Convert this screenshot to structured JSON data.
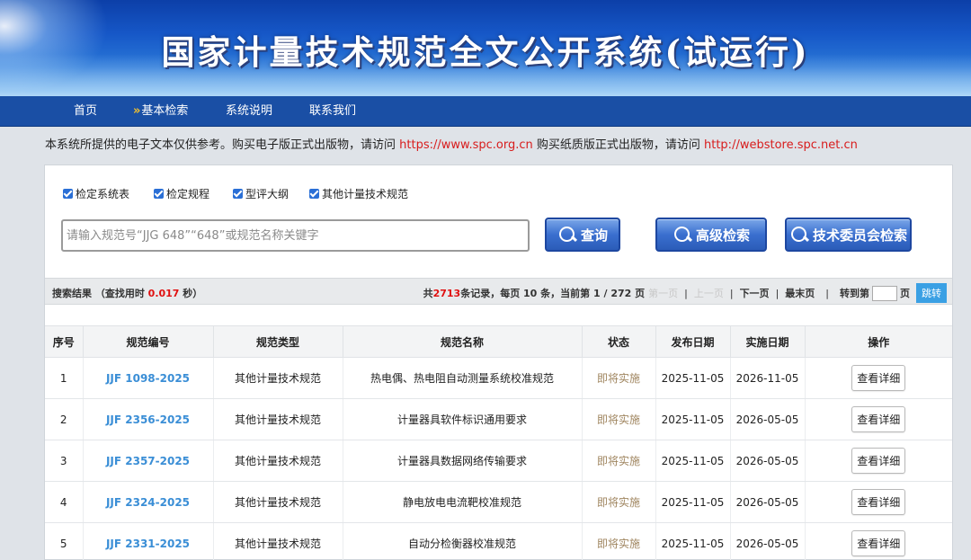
{
  "banner": {
    "title": "国家计量技术规范全文公开系统(试运行)"
  },
  "nav": {
    "items": [
      {
        "label": "首页",
        "active": false
      },
      {
        "label": "基本检索",
        "active": true,
        "marker": "»"
      },
      {
        "label": "系统说明",
        "active": false
      },
      {
        "label": "联系我们",
        "active": false
      }
    ]
  },
  "notice": {
    "text1": "本系统所提供的电子文本仅供参考。购买电子版正式出版物，请访问 ",
    "link1": "https://www.spc.org.cn",
    "text2": " 购买纸质版正式出版物，请访问 ",
    "link2": "http://webstore.spc.net.cn"
  },
  "filters": [
    {
      "label": "检定系统表",
      "checked": true
    },
    {
      "label": "检定规程",
      "checked": true
    },
    {
      "label": "型评大纲",
      "checked": true
    },
    {
      "label": "其他计量技术规范",
      "checked": true
    }
  ],
  "search": {
    "placeholder": "请输入规范号“JJG 648”“648”或规范名称关键字",
    "query_label": "查询",
    "advanced_label": "高级检索",
    "committee_label": "技术委员会检索"
  },
  "results": {
    "prefix": "搜索结果 （查找用时 ",
    "time": "0.017",
    "suffix": " 秒）",
    "total_prefix": "共",
    "total": "2713",
    "total_suffix": "条记录，每页 10 条，当前第 1 / 272 页",
    "first": "第一页",
    "prev": "上一页",
    "next": "下一页",
    "last": "最末页",
    "goto_prefix": "转到第",
    "goto_suffix": "页",
    "jump": "跳转"
  },
  "table": {
    "headers": [
      "序号",
      "规范编号",
      "规范类型",
      "规范名称",
      "状态",
      "发布日期",
      "实施日期",
      "操作"
    ],
    "rows": [
      {
        "no": "1",
        "code": "JJF 1098-2025",
        "type": "其他计量技术规范",
        "name": "热电偶、热电阻自动测量系统校准规范",
        "status": "即将实施",
        "publish": "2025-11-05",
        "effective": "2026-11-05",
        "action": "查看详细"
      },
      {
        "no": "2",
        "code": "JJF 2356-2025",
        "type": "其他计量技术规范",
        "name": "计量器具软件标识通用要求",
        "status": "即将实施",
        "publish": "2025-11-05",
        "effective": "2026-05-05",
        "action": "查看详细"
      },
      {
        "no": "3",
        "code": "JJF 2357-2025",
        "type": "其他计量技术规范",
        "name": "计量器具数据网络传输要求",
        "status": "即将实施",
        "publish": "2025-11-05",
        "effective": "2026-05-05",
        "action": "查看详细"
      },
      {
        "no": "4",
        "code": "JJF 2324-2025",
        "type": "其他计量技术规范",
        "name": "静电放电电流靶校准规范",
        "status": "即将实施",
        "publish": "2025-11-05",
        "effective": "2026-05-05",
        "action": "查看详细"
      },
      {
        "no": "5",
        "code": "JJF 2331-2025",
        "type": "其他计量技术规范",
        "name": "自动分检衡器校准规范",
        "status": "即将实施",
        "publish": "2025-11-05",
        "effective": "2026-05-05",
        "action": "查看详细"
      }
    ]
  },
  "colors": {
    "nav_bg": "#1a4fa5",
    "link_red": "#d81c1c",
    "code_blue": "#3a8ed6",
    "status_brown": "#a08660",
    "jump_blue": "#3aa0e4"
  }
}
